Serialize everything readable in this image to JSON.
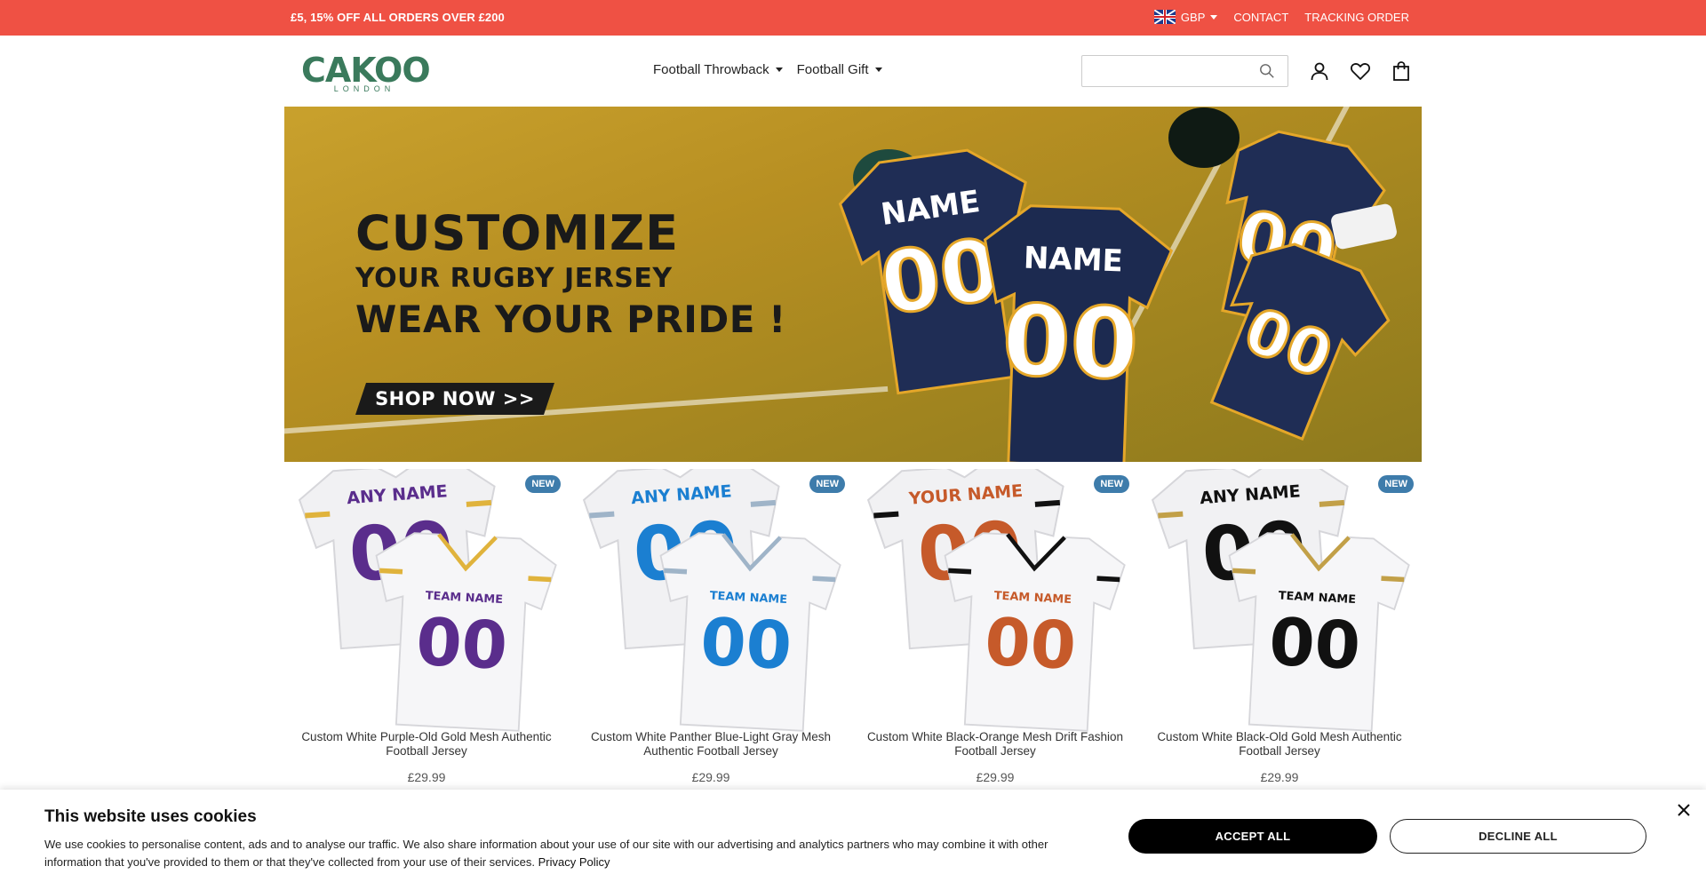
{
  "promo": {
    "text": "£5, 15% OFF ALL ORDERS OVER £200",
    "currency": "GBP",
    "contact": "CONTACT",
    "tracking": "TRACKING ORDER"
  },
  "header": {
    "logo_word": "CAKOO",
    "logo_sub": "LONDON",
    "nav": [
      {
        "label": "Football Throwback"
      },
      {
        "label": "Football Gift"
      }
    ],
    "search_placeholder": ""
  },
  "banner": {
    "line1": "CUSTOMIZE",
    "line2": "YOUR RUGBY JERSEY",
    "line3": "WEAR YOUR PRIDE !",
    "cta": "SHOP NOW >>",
    "jersey_name": "NAME",
    "jersey_number": "00",
    "colors": {
      "navy": "#1f2d55",
      "gold": "#e5a729",
      "field": "#b9921f"
    }
  },
  "products": [
    {
      "badge": "NEW",
      "name": "Custom White Purple-Old Gold Mesh Authentic Football Jersey",
      "price": "£29.99",
      "front_text": "ANY NAME",
      "back_text": "TEAM NAME",
      "number": "00",
      "number_color": "#5a2d8c",
      "trim": "#e0b33c"
    },
    {
      "badge": "NEW",
      "name": "Custom White Panther Blue-Light Gray Mesh Authentic Football Jersey",
      "price": "£29.99",
      "front_text": "ANY NAME",
      "back_text": "TEAM NAME",
      "number": "00",
      "number_color": "#1b7fd1",
      "trim": "#9fb4c8"
    },
    {
      "badge": "NEW",
      "name": "Custom White Black-Orange Mesh Drift Fashion Football Jersey",
      "price": "£29.99",
      "front_text": "YOUR NAME",
      "back_text": "TEAM NAME",
      "number": "00",
      "number_color": "#c65a2a",
      "trim": "#111111"
    },
    {
      "badge": "NEW",
      "name": "Custom White Black-Old Gold Mesh Authentic Football Jersey",
      "price": "£29.99",
      "front_text": "ANY NAME",
      "back_text": "TEAM NAME",
      "number": "00",
      "number_color": "#111111",
      "trim": "#c2a048"
    }
  ],
  "cookie": {
    "title": "This website uses cookies",
    "text": "We use cookies to personalise content, ads and to analyse our traffic. We also share information about your use of our site with our advertising and analytics partners who may combine it with other information that you've provided to them or that they've collected from your use of their services.",
    "link": "Privacy Policy",
    "accept": "ACCEPT ALL",
    "decline": "DECLINE ALL"
  }
}
